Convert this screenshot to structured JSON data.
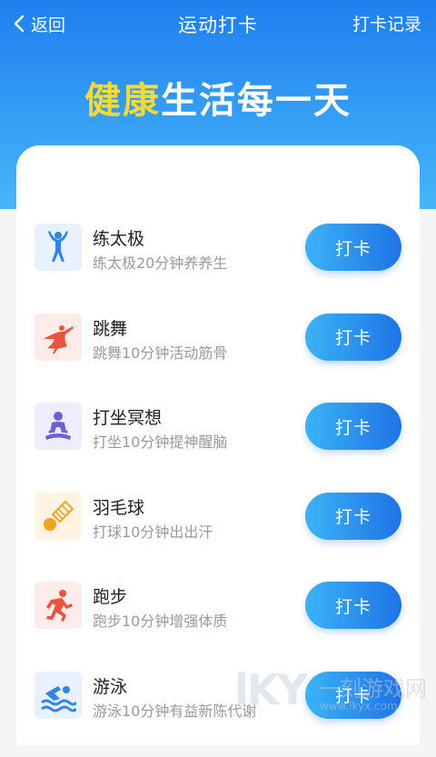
{
  "header": {
    "back_label": "返回",
    "title": "运动打卡",
    "record_label": "打卡记录"
  },
  "slogan": {
    "highlight": "健康",
    "rest": "生活每一天",
    "highlight_color": "#FFD933"
  },
  "colors": {
    "header_gradient_top": "#1F7FF0",
    "header_gradient_bottom": "#47B6F7",
    "button_gradient_left": "#3AB3F5",
    "button_gradient_right": "#1F74E6"
  },
  "activities": [
    {
      "name": "练太极",
      "desc": "练太极20分钟养养生",
      "button": "打卡",
      "icon": "tai-chi-icon"
    },
    {
      "name": "跳舞",
      "desc": "跳舞10分钟活动筋骨",
      "button": "打卡",
      "icon": "dance-icon"
    },
    {
      "name": "打坐冥想",
      "desc": "打坐10分钟提神醒脑",
      "button": "打卡",
      "icon": "meditation-icon"
    },
    {
      "name": "羽毛球",
      "desc": "打球10分钟出出汗",
      "button": "打卡",
      "icon": "badminton-icon"
    },
    {
      "name": "跑步",
      "desc": "跑步10分钟增强体质",
      "button": "打卡",
      "icon": "running-icon"
    },
    {
      "name": "游泳",
      "desc": "游泳10分钟有益新陈代谢",
      "button": "打卡",
      "icon": "swimming-icon"
    }
  ],
  "watermark": {
    "logo": "lKY",
    "text": "一刻游戏网",
    "url": "www.ikyx.com"
  }
}
